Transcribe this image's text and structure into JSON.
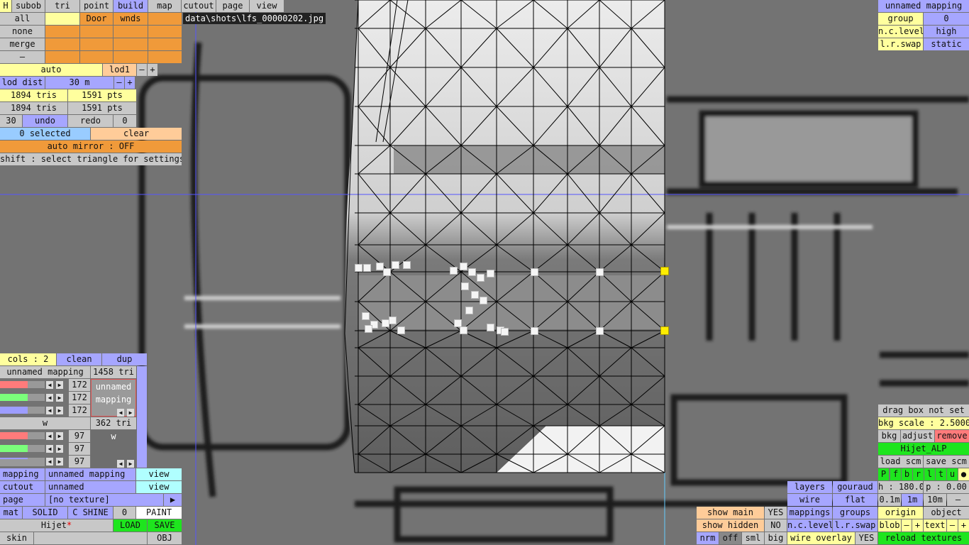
{
  "file_path": "data\\shots\\lfs_00000202.jpg",
  "top_tabs": [
    "H",
    "subob",
    "tri",
    "point",
    "build",
    "map",
    "cutout",
    "page",
    "view"
  ],
  "sel_row": {
    "all": "all",
    "door": "Door",
    "wnds": "wnds"
  },
  "left_rows": [
    "none",
    "merge",
    "–"
  ],
  "lod": {
    "auto": "auto",
    "lod": "lod1",
    "minus": "–",
    "plus": "+",
    "dist_label": "lod dist",
    "dist_value": "30 m"
  },
  "counts": {
    "tris1": "1894 tris",
    "pts1": "1591 pts",
    "tris2": "1894 tris",
    "pts2": "1591 pts"
  },
  "undo": {
    "n": "30",
    "undo": "undo",
    "redo": "redo",
    "count": "0"
  },
  "selected": "0 selected",
  "clear": "clear",
  "auto_mirror": "auto mirror : OFF",
  "hint": "shift : select triangle for settings",
  "cols": {
    "cols": "cols : 2",
    "clean": "clean",
    "dup": "dup"
  },
  "mapping1": {
    "name": "unnamed mapping",
    "tri": "1458 tri",
    "r": "172",
    "g": "172",
    "b": "172",
    "box": "unnamed mapping"
  },
  "mapping2": {
    "name": "w",
    "tri": "362 tri",
    "r": "97",
    "g": "97",
    "b": "97",
    "box": "w"
  },
  "bottom_left": {
    "mapping_label": "mapping",
    "mapping_value": "unnamed mapping",
    "view1": "view",
    "cutout_label": "cutout",
    "cutout_value": "unnamed",
    "view2": "view",
    "page_label": "page",
    "page_value": "[no texture]",
    "page_arrow": "▶",
    "mat": "mat",
    "solid": "SOLID",
    "cshine": "C SHINE",
    "zero": "0",
    "paint": "PAINT",
    "car": "Hijet",
    "star": "*",
    "load": "LOAD",
    "save": "SAVE",
    "skin": "skin",
    "obj": "OBJ"
  },
  "top_right": {
    "title": "unnamed mapping",
    "group_label": "group",
    "group_value": "0",
    "nc_label": "n.c.level",
    "nc_value": "high",
    "lr_label": "l.r.swap",
    "lr_value": "static"
  },
  "bkg": {
    "drag": "drag box not set",
    "scale": "bkg scale : 2.5000",
    "bkg": "bkg",
    "adjust": "adjust",
    "remove": "remove",
    "name": "Hijet_ALP",
    "load_scm": "load scm",
    "save_scm": "save scm",
    "flags": [
      "P",
      "f",
      "b",
      "r",
      "l",
      "t",
      "u",
      "●"
    ],
    "h": "h : 180.00",
    "p": "p : 0.00",
    "steps": [
      "0.1m",
      "1m",
      "10m",
      "–"
    ],
    "origin": "origin",
    "object": "object",
    "blob": "blob",
    "text": "text",
    "reload": "reload textures"
  },
  "view_opts": {
    "layers": "layers",
    "gouraud": "gouraud",
    "wire": "wire",
    "flat": "flat",
    "mappings": "mappings",
    "groups": "groups",
    "nclevel": "n.c.level",
    "lrswap": "l.r.swap",
    "wire_overlay": "wire overlay",
    "yes3": "YES"
  },
  "show": {
    "main": "show main",
    "main_v": "YES",
    "hidden": "show hidden",
    "hidden_v": "NO",
    "nrm": "nrm",
    "off": "off",
    "sml": "sml",
    "big": "big"
  },
  "colors": {
    "yellow": "#ffff9e",
    "blue": "#a6a6ff",
    "orange": "#f09a3a",
    "green": "#1ee51e"
  }
}
